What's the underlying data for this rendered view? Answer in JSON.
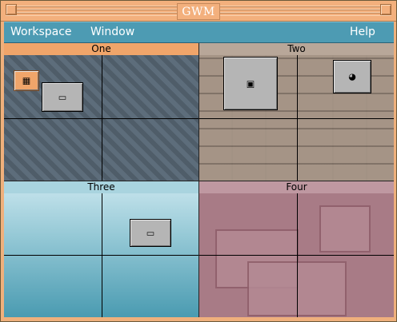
{
  "window": {
    "title": "GWM"
  },
  "menubar": {
    "left": [
      "Workspace",
      "Window"
    ],
    "right": [
      "Help"
    ]
  },
  "pager": {
    "workspaces": [
      {
        "name": "One"
      },
      {
        "name": "Two"
      },
      {
        "name": "Three"
      },
      {
        "name": "Four"
      }
    ]
  },
  "icons": {
    "one_a": "tool-grid-icon",
    "one_b": "terminal-icon",
    "two_a": "window-icon",
    "two_b": "palette-icon",
    "three_a": "terminal-icon"
  },
  "colors": {
    "titlebar": "#f3b07d",
    "menubar": "#4d9bb3",
    "ws_one": "#5d6d7b",
    "ws_two": "#a59486",
    "ws_three": "#8fc5d3",
    "ws_four": "#a87b86"
  }
}
